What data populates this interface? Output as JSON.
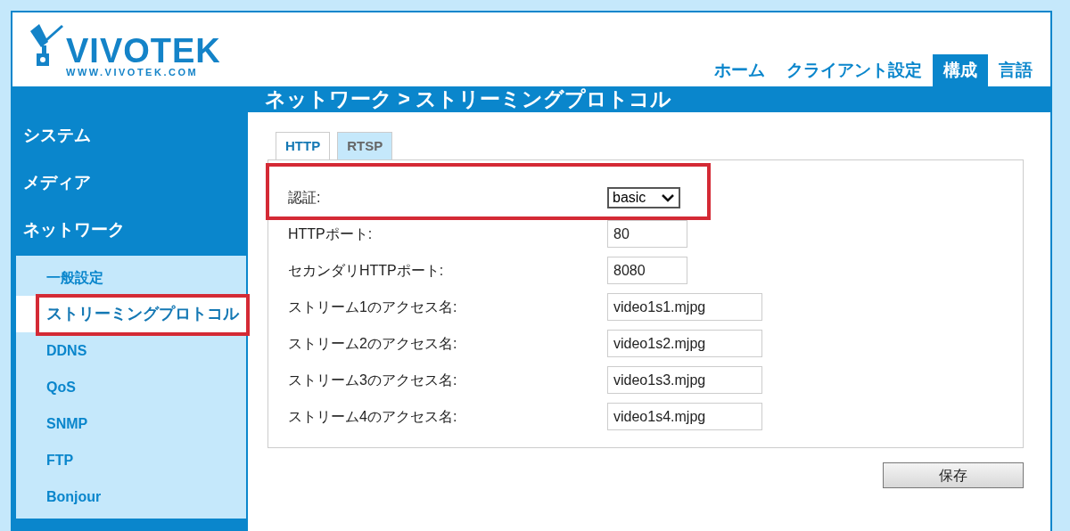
{
  "logo": {
    "name": "VIVOTEK",
    "url": "WWW.VIVOTEK.COM"
  },
  "nav": [
    {
      "label": "ホーム",
      "selected": false
    },
    {
      "label": "クライアント設定",
      "selected": false
    },
    {
      "label": "構成",
      "selected": true
    },
    {
      "label": "言語",
      "selected": false
    }
  ],
  "page_title": "ネットワーク > ストリーミングプロトコル",
  "sidebar": {
    "items": [
      {
        "label": "システム"
      },
      {
        "label": "メディア"
      },
      {
        "label": "ネットワーク",
        "children": [
          {
            "label": "一般設定",
            "selected": false,
            "highlighted": false
          },
          {
            "label": "ストリーミングプロトコル",
            "selected": true,
            "highlighted": true
          },
          {
            "label": "DDNS",
            "selected": false,
            "highlighted": false
          },
          {
            "label": "QoS",
            "selected": false,
            "highlighted": false
          },
          {
            "label": "SNMP",
            "selected": false,
            "highlighted": false
          },
          {
            "label": "FTP",
            "selected": false,
            "highlighted": false
          },
          {
            "label": "Bonjour",
            "selected": false,
            "highlighted": false
          }
        ]
      }
    ]
  },
  "tabs": [
    {
      "label": "HTTP",
      "selected": true
    },
    {
      "label": "RTSP",
      "selected": false
    }
  ],
  "fields": [
    {
      "kind": "select",
      "label": "認証:",
      "value": "basic",
      "highlighted": true
    },
    {
      "kind": "port",
      "label": "HTTPポート:",
      "value": "80",
      "highlighted": false
    },
    {
      "kind": "port",
      "label": "セカンダリHTTPポート:",
      "value": "8080",
      "highlighted": false
    },
    {
      "kind": "name",
      "label": "ストリーム1のアクセス名:",
      "value": "video1s1.mjpg",
      "highlighted": false
    },
    {
      "kind": "name",
      "label": "ストリーム2のアクセス名:",
      "value": "video1s2.mjpg",
      "highlighted": false
    },
    {
      "kind": "name",
      "label": "ストリーム3のアクセス名:",
      "value": "video1s3.mjpg",
      "highlighted": false
    },
    {
      "kind": "name",
      "label": "ストリーム4のアクセス名:",
      "value": "video1s4.mjpg",
      "highlighted": false
    }
  ],
  "save_button": "保存"
}
